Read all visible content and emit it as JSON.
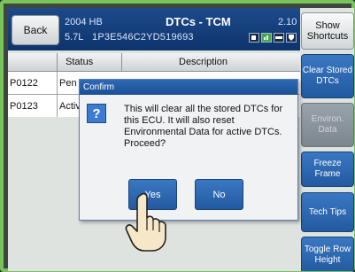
{
  "header": {
    "back_label": "Back",
    "year": "2004 HB",
    "title": "DTCs - TCM",
    "version": "2.10",
    "engine": "5.7L",
    "vin": "1P3E546C2YD519693"
  },
  "sidebar": {
    "show_shortcuts": "Show Shortcuts",
    "clear_stored": "Clear Stored DTCs",
    "environ_data": "Environ. Data",
    "freeze_frame": "Freeze Frame",
    "tech_tips": "Tech Tips",
    "toggle_row_height": "Toggle Row Height"
  },
  "table": {
    "columns": [
      "Status",
      "Description"
    ],
    "rows": [
      {
        "code": "P0122",
        "status": "Pen"
      },
      {
        "code": "P0123",
        "status": "Activ"
      }
    ]
  },
  "dialog": {
    "title": "Confirm",
    "message": "This will clear all the stored DTCs for this ECU.  It will also reset Environmental Data for active DTCs. Proceed?",
    "yes": "Yes",
    "no": "No",
    "icon": "question-icon"
  },
  "colors": {
    "frame_green": "#78c35a",
    "header_blue": "#0e336c",
    "button_blue": "#235aa0"
  }
}
